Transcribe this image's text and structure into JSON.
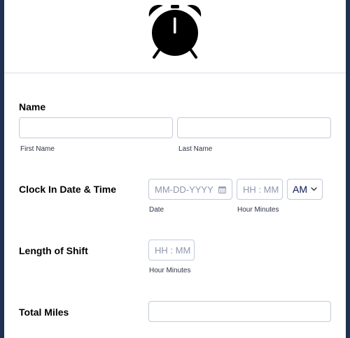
{
  "header": {
    "logo_icon": "alarm-clock-icon"
  },
  "name_field": {
    "label": "Name",
    "first_sublabel": "First Name",
    "last_sublabel": "Last Name",
    "first_value": "",
    "last_value": ""
  },
  "clock_in": {
    "label": "Clock In Date & Time",
    "date_placeholder": "MM-DD-YYYY",
    "date_sublabel": "Date",
    "time_placeholder": "HH : MM",
    "time_sublabel": "Hour Minutes",
    "ampm_value": "AM",
    "calendar_icon": "calendar-icon"
  },
  "shift_length": {
    "label": "Length of Shift",
    "time_placeholder": "HH : MM",
    "time_sublabel": "Hour Minutes"
  },
  "total_miles": {
    "label": "Total Miles",
    "value": ""
  },
  "colors": {
    "page_background": "#1f3150",
    "card_background": "#ffffff",
    "input_border": "#c3cad8",
    "label_text": "#000000"
  }
}
